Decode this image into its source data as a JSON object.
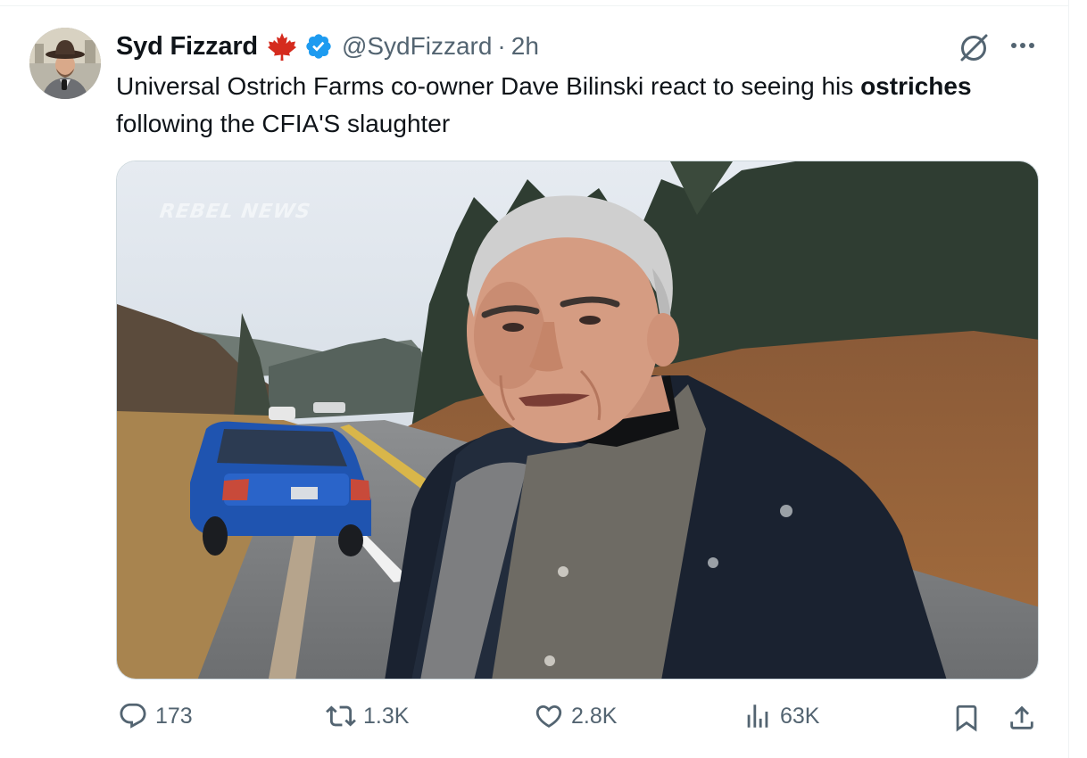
{
  "author": {
    "display_name": "Syd Fizzard",
    "handle": "@SydFizzard",
    "time": "2h",
    "separator": "·"
  },
  "tweet": {
    "text_part1": "Universal Ostrich Farms co-owner Dave Bilinski react to seeing his ",
    "text_bold": "ostriches",
    "text_part2": " following the CFIA'S slaughter"
  },
  "media": {
    "watermark": "REBEL NEWS"
  },
  "actions": {
    "replies": "173",
    "reposts": "1.3K",
    "likes": "2.8K",
    "views": "63K"
  },
  "colors": {
    "verified": "#1d9bf0",
    "maple_leaf": "#d52b1e",
    "secondary_text": "#536471"
  },
  "icons": {
    "reply": "reply-icon",
    "repost": "repost-icon",
    "like": "like-icon",
    "views": "views-icon",
    "bookmark": "bookmark-icon",
    "share": "share-icon",
    "grok": "grok-icon",
    "more": "more-icon",
    "verified": "verified-badge-icon",
    "flag": "canada-maple-leaf-icon"
  }
}
